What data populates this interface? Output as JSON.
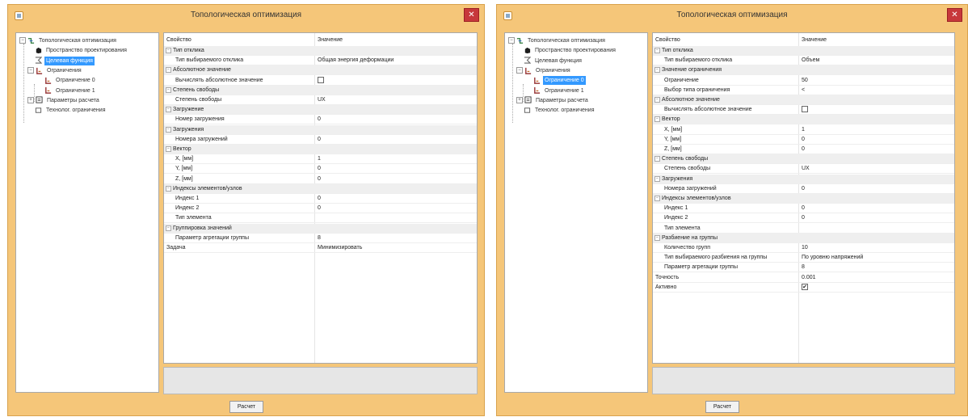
{
  "colors": {
    "frame": "#f5c679",
    "close": "#c7383b",
    "selection": "#3399ff",
    "category": "#efefef"
  },
  "windows": [
    {
      "title": "Топологическая оптимизация",
      "close": "✕",
      "tree": [
        {
          "label": "Топологическая оптимизация",
          "level": 0,
          "icon": "opt-icon",
          "expander": "−"
        },
        {
          "label": "Пространство проектирования",
          "level": 1,
          "icon": "cube-icon"
        },
        {
          "label": "Целевая функция",
          "level": 1,
          "icon": "function-icon",
          "selected": true
        },
        {
          "label": "Ограничения",
          "level": 1,
          "icon": "constraint-icon",
          "expander": "−"
        },
        {
          "label": "Ограничение 0",
          "level": 2,
          "icon": "constraint-icon"
        },
        {
          "label": "Ограничение 1",
          "level": 2,
          "icon": "constraint-icon"
        },
        {
          "label": "Параметры расчета",
          "level": 1,
          "icon": "params-icon",
          "expander": "+"
        },
        {
          "label": "Технолог. ограничения",
          "level": 1,
          "icon": "tech-icon"
        }
      ],
      "grid": {
        "header": {
          "property": "Свойство",
          "value": "Значение"
        },
        "rows": [
          {
            "k": "Тип отклика",
            "type": "cat"
          },
          {
            "k": "Тип выбираемого отклика",
            "v": "Общая энергия деформации"
          },
          {
            "k": "Абсолютное значение",
            "type": "cat"
          },
          {
            "k": "Вычислять абсолютное значение",
            "check": false
          },
          {
            "k": "Степень свободы",
            "type": "cat"
          },
          {
            "k": "Степень свободы",
            "v": "UX"
          },
          {
            "k": "Загружение",
            "type": "cat"
          },
          {
            "k": "Номер загружения",
            "v": "0"
          },
          {
            "k": "Загружения",
            "type": "cat"
          },
          {
            "k": "Номера загружений",
            "v": "0"
          },
          {
            "k": "Вектор",
            "type": "cat"
          },
          {
            "k": "X, [мм]",
            "v": "1"
          },
          {
            "k": "Y, [мм]",
            "v": "0"
          },
          {
            "k": "Z, [мм]",
            "v": "0"
          },
          {
            "k": "Индексы элементов/узлов",
            "type": "cat"
          },
          {
            "k": "Индекс 1",
            "v": "0"
          },
          {
            "k": "Индекс 2",
            "v": "0"
          },
          {
            "k": "Тип элемента",
            "v": ""
          },
          {
            "k": "Группировка значений",
            "type": "cat"
          },
          {
            "k": "Параметр агрегации группы",
            "v": "8"
          },
          {
            "k": "Задача",
            "v": "Минимизировать",
            "type": "top"
          }
        ]
      },
      "button": "Расчет"
    },
    {
      "title": "Топологическая оптимизация",
      "close": "✕",
      "tree": [
        {
          "label": "Топологическая оптимизация",
          "level": 0,
          "icon": "opt-icon",
          "expander": "−"
        },
        {
          "label": "Пространство проектирования",
          "level": 1,
          "icon": "cube-icon"
        },
        {
          "label": "Целевая функция",
          "level": 1,
          "icon": "function-icon"
        },
        {
          "label": "Ограничения",
          "level": 1,
          "icon": "constraint-icon",
          "expander": "−"
        },
        {
          "label": "Ограничение 0",
          "level": 2,
          "icon": "constraint-icon",
          "selected": true
        },
        {
          "label": "Ограничение 1",
          "level": 2,
          "icon": "constraint-icon"
        },
        {
          "label": "Параметры расчета",
          "level": 1,
          "icon": "params-icon",
          "expander": "+"
        },
        {
          "label": "Технолог. ограничения",
          "level": 1,
          "icon": "tech-icon"
        }
      ],
      "grid": {
        "header": {
          "property": "Свойство",
          "value": "Значение"
        },
        "rows": [
          {
            "k": "Тип отклика",
            "type": "cat"
          },
          {
            "k": "Тип выбираемого отклика",
            "v": "Объем"
          },
          {
            "k": "Значение ограничения",
            "type": "cat"
          },
          {
            "k": "Ограничение",
            "v": "50"
          },
          {
            "k": "Выбор типа ограничения",
            "v": "<"
          },
          {
            "k": "Абсолютное значение",
            "type": "cat"
          },
          {
            "k": "Вычислять абсолютное значение",
            "check": false
          },
          {
            "k": "Вектор",
            "type": "cat"
          },
          {
            "k": "X, [мм]",
            "v": "1"
          },
          {
            "k": "Y, [мм]",
            "v": "0"
          },
          {
            "k": "Z, [мм]",
            "v": "0"
          },
          {
            "k": "Степень свободы",
            "type": "cat"
          },
          {
            "k": "Степень свободы",
            "v": "UX"
          },
          {
            "k": "Загружения",
            "type": "cat"
          },
          {
            "k": "Номера загружений",
            "v": "0"
          },
          {
            "k": "Индексы элементов/узлов",
            "type": "cat"
          },
          {
            "k": "Индекс 1",
            "v": "0"
          },
          {
            "k": "Индекс 2",
            "v": "0"
          },
          {
            "k": "Тип элемента",
            "v": ""
          },
          {
            "k": "Разбиение на группы",
            "type": "cat"
          },
          {
            "k": "Количество групп",
            "v": "10"
          },
          {
            "k": "Тип выбираемого разбиения на группы",
            "v": "По уровню напряжений"
          },
          {
            "k": "Параметр агрегации группы",
            "v": "8"
          },
          {
            "k": "Точность",
            "v": "0.001",
            "type": "top"
          },
          {
            "k": "Активно",
            "check": true,
            "type": "top"
          }
        ]
      },
      "button": "Расчет"
    }
  ]
}
